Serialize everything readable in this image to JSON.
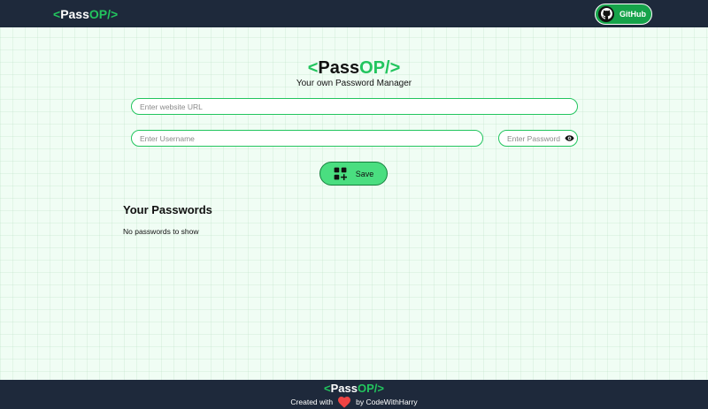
{
  "navbar": {
    "logo": {
      "open": "<",
      "pass": "Pass",
      "op": "OP/>"
    },
    "github_label": "GitHub"
  },
  "hero": {
    "logo": {
      "open": "<",
      "pass": "Pass",
      "op": "OP/>"
    },
    "tagline": "Your own Password Manager"
  },
  "form": {
    "url_placeholder": "Enter website URL",
    "url_value": "",
    "username_placeholder": "Enter Username",
    "username_value": "",
    "password_placeholder": "Enter Password",
    "password_value": "",
    "save_label": "Save"
  },
  "passwords": {
    "title": "Your Passwords",
    "empty_message": "No passwords to show"
  },
  "footer": {
    "logo": {
      "open": "<",
      "pass": "Pass",
      "op": "OP/>"
    },
    "created_with": "Created with",
    "by": "by CodeWithHarry"
  },
  "icons": {
    "github": "github-icon",
    "eye": "eye-icon",
    "save": "add-grid-icon",
    "heart": "heart-icon"
  },
  "colors": {
    "navbar_bg": "#1e293b",
    "accent_green": "#22c55e",
    "save_button_bg": "#4ade80",
    "page_bg": "#f0fdf4",
    "heart": "#ef4444"
  }
}
